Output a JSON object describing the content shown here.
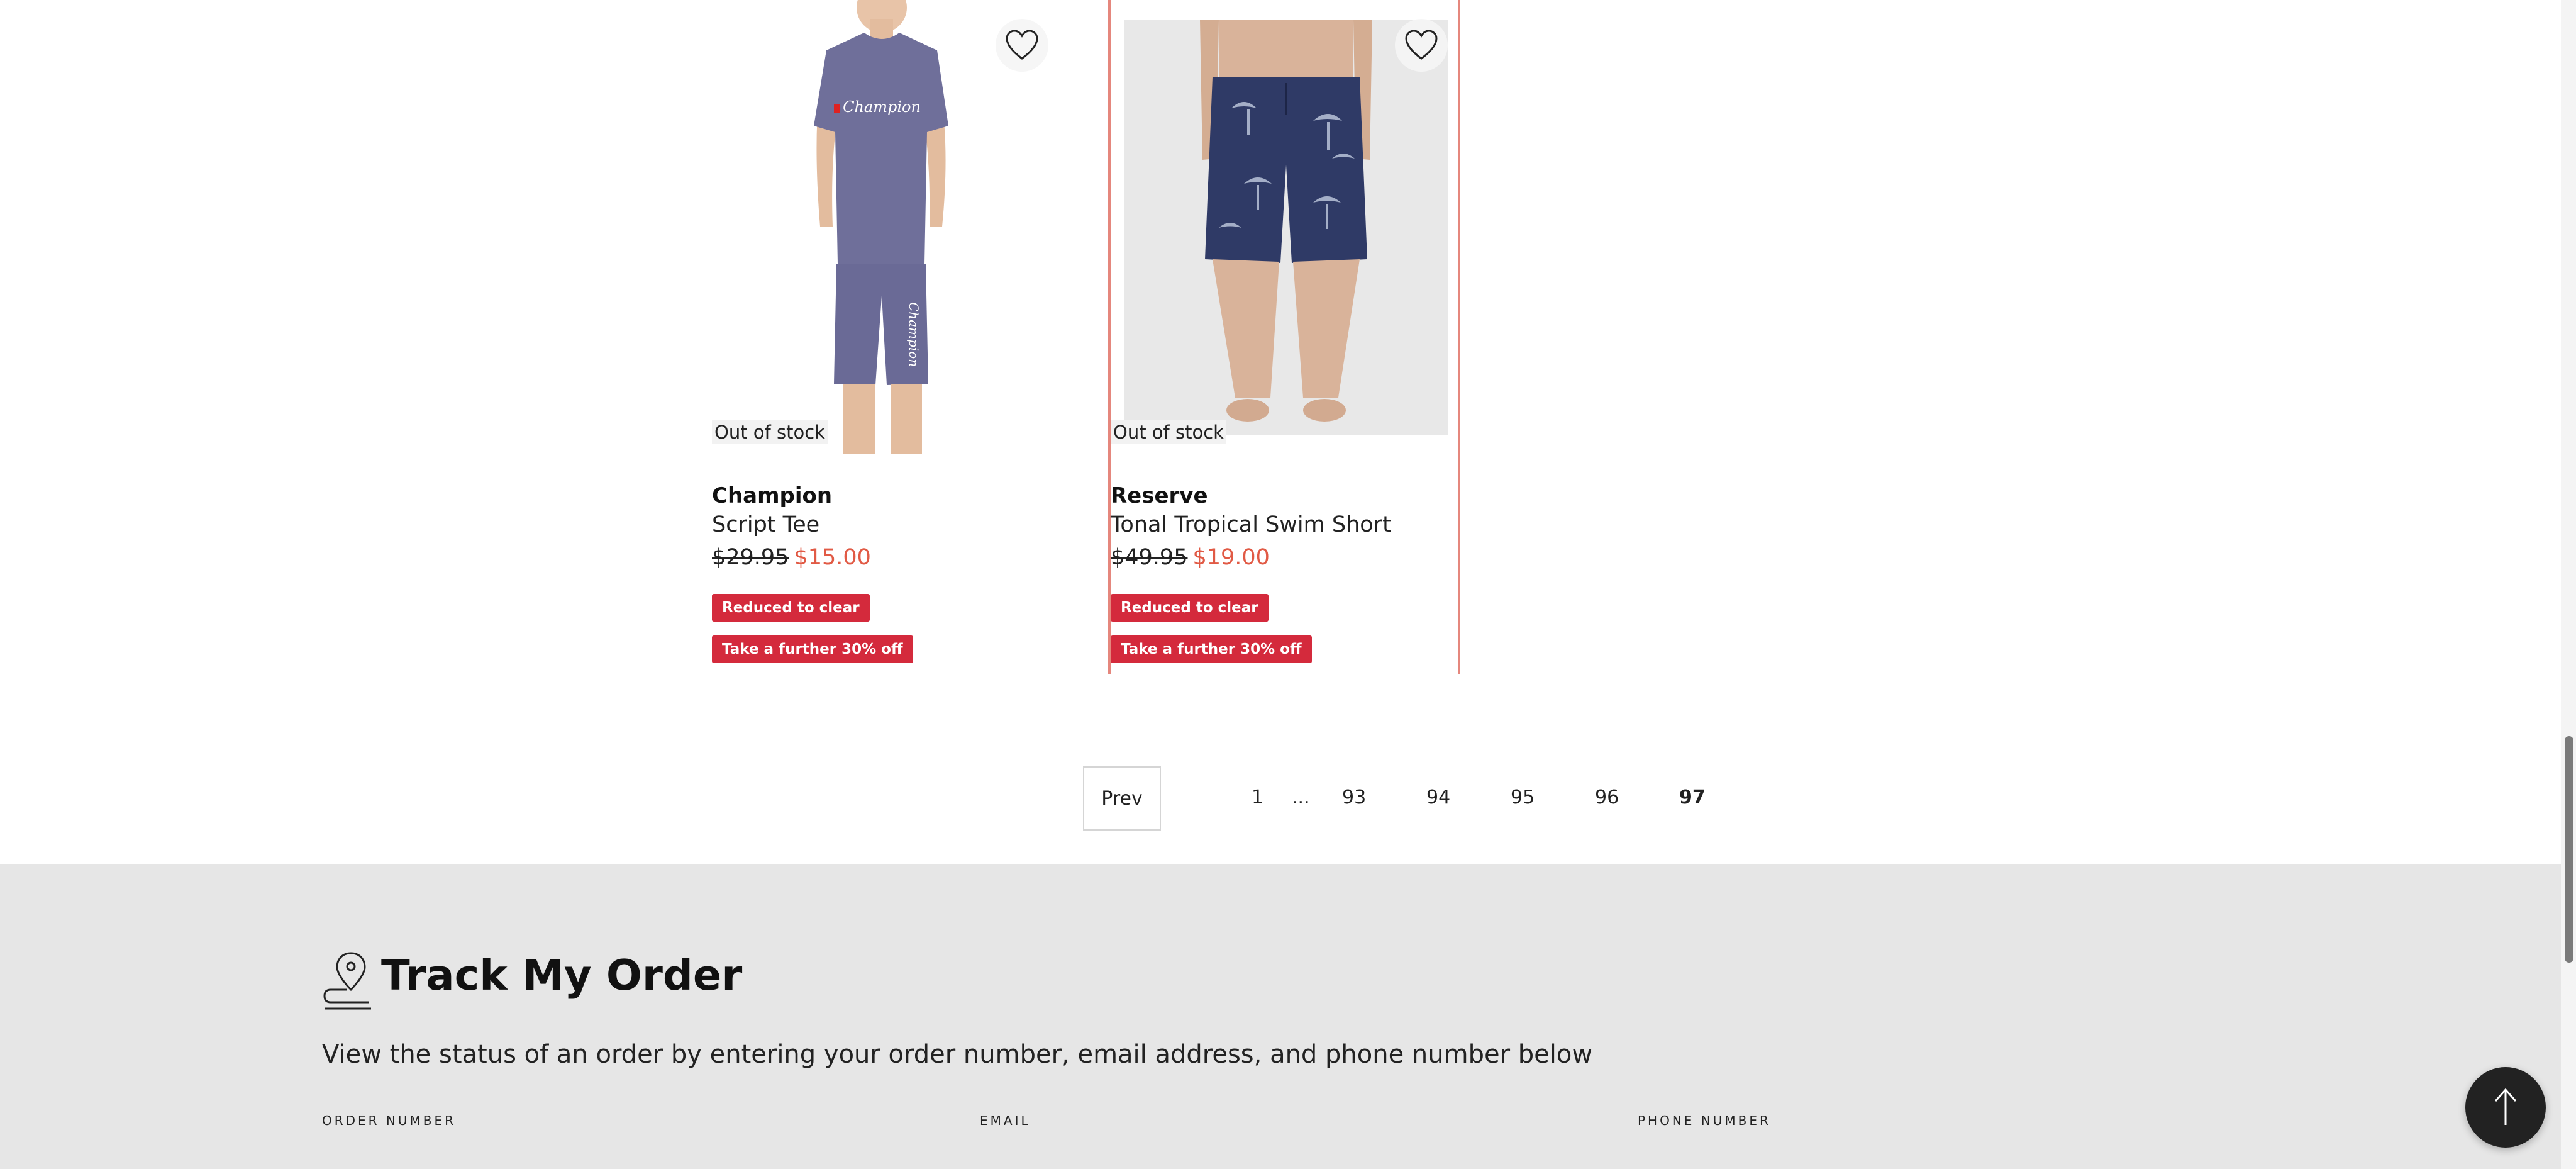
{
  "products": [
    {
      "stock_label": "Out of stock",
      "brand": "Champion",
      "name": "Script Tee",
      "price_original": "$29.95",
      "price_sale": "$15.00",
      "badges": [
        "Reduced to clear",
        "Take a further 30% off"
      ],
      "image_logo_text": "Champion"
    },
    {
      "stock_label": "Out of stock",
      "brand": "Reserve",
      "name": "Tonal Tropical Swim Short",
      "price_original": "$49.95",
      "price_sale": "$19.00",
      "badges": [
        "Reduced to clear",
        "Take a further 30% off"
      ]
    }
  ],
  "pagination": {
    "prev_label": "Prev",
    "pages": [
      "1",
      "...",
      "93",
      "94",
      "95",
      "96",
      "97"
    ],
    "current": "97"
  },
  "track_order": {
    "title": "Track My Order",
    "description": "View the status of an order by entering your order number, email address, and phone number below",
    "fields": [
      "ORDER NUMBER",
      "EMAIL",
      "PHONE NUMBER"
    ]
  },
  "icons": {
    "wishlist": "heart-icon",
    "track": "location-pin-icon",
    "back_to_top": "arrow-up-icon"
  },
  "colors": {
    "sale_price": "#e15a45",
    "badge": "#d42a3c",
    "selected_outline": "#e5877d",
    "footer_bg": "#e6e6e6"
  }
}
